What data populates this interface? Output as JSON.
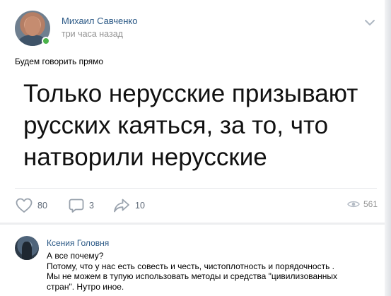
{
  "post": {
    "author": "Михаил Савченко",
    "time": "три часа назад",
    "caption": "Будем говорить прямо",
    "big_text": "Только нерусские призывают\nрусских каяться, за то, что\nнатворили нерусские"
  },
  "actions": {
    "likes": "80",
    "comments": "3",
    "shares": "10",
    "views": "561"
  },
  "comment": {
    "author": "Ксения Головня",
    "text": "А все почему?\nПотому, что у нас есть совесть и честь, чистоплотность и порядочность .\nМы не можем в тупую использовать методы и средства \"цивилизованных\nстран\". Нутро иное."
  },
  "colors": {
    "link": "#2a5885",
    "secondary": "#939393",
    "online": "#4bb34b",
    "icon": "#99a2ad"
  }
}
